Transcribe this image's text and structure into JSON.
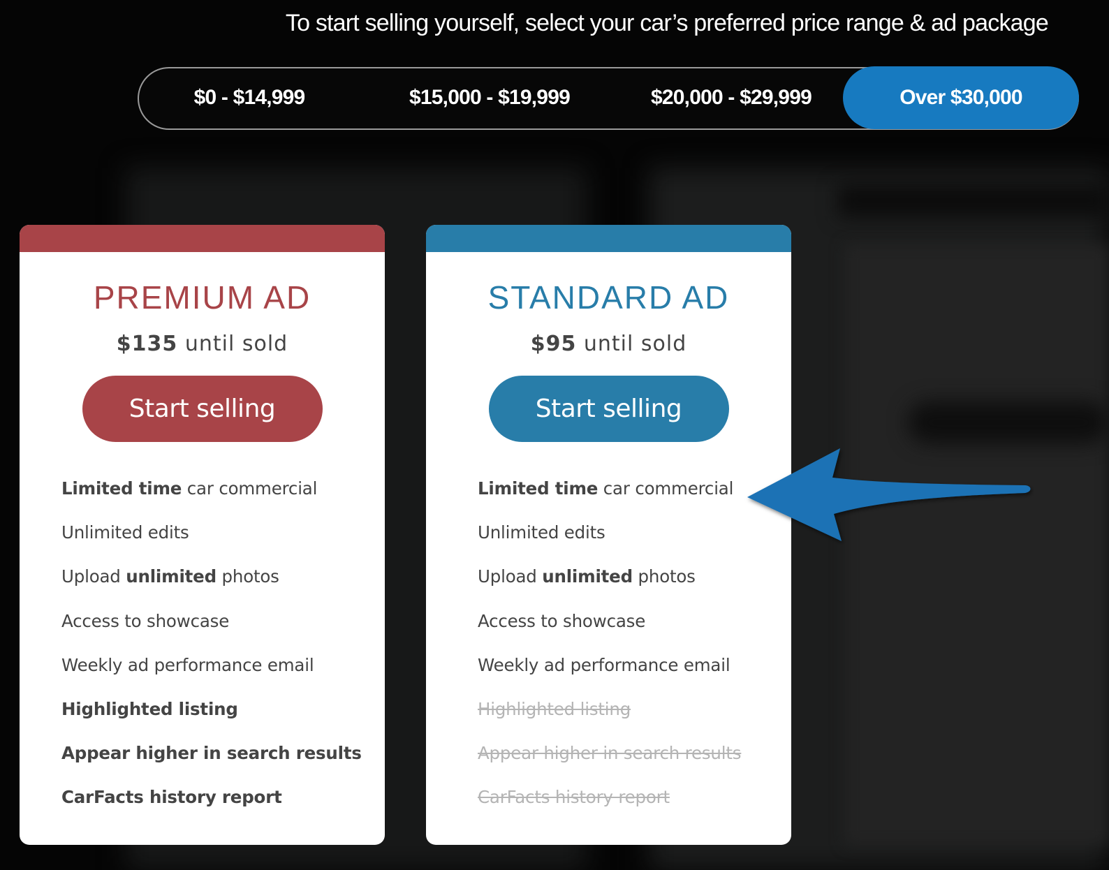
{
  "headline": "To start selling yourself, select your car’s preferred price range & ad package",
  "price_ranges": {
    "selected_index": 3,
    "options": [
      {
        "label": "$0 - $14,999",
        "selected": false
      },
      {
        "label": "$15,000 - $19,999",
        "selected": false
      },
      {
        "label": "$20,000 - $29,999",
        "selected": false
      },
      {
        "label": "Over $30,000",
        "selected": true
      }
    ]
  },
  "colors": {
    "premium": "#a84448",
    "standard": "#287da9",
    "selected_range": "#177ac0",
    "annotation_arrow": "#1b72b5"
  },
  "packages": [
    {
      "name": "PREMIUM AD",
      "price": "$135",
      "price_suffix": " until sold",
      "cta": "Start selling",
      "features": [
        {
          "parts": [
            {
              "text": "Limited time",
              "bold": true
            },
            {
              "text": " car commercial",
              "bold": false
            }
          ],
          "included": true
        },
        {
          "parts": [
            {
              "text": "Unlimited edits",
              "bold": false
            }
          ],
          "included": true
        },
        {
          "parts": [
            {
              "text": "Upload ",
              "bold": false
            },
            {
              "text": "unlimited",
              "bold": true
            },
            {
              "text": " photos",
              "bold": false
            }
          ],
          "included": true
        },
        {
          "parts": [
            {
              "text": "Access to showcase",
              "bold": false
            }
          ],
          "included": true
        },
        {
          "parts": [
            {
              "text": "Weekly ad performance email",
              "bold": false
            }
          ],
          "included": true
        },
        {
          "parts": [
            {
              "text": "Highlighted listing",
              "bold": true
            }
          ],
          "included": true
        },
        {
          "parts": [
            {
              "text": "Appear higher in search results",
              "bold": true
            }
          ],
          "included": true
        },
        {
          "parts": [
            {
              "text": "CarFacts history report",
              "bold": true
            }
          ],
          "included": true
        }
      ]
    },
    {
      "name": "STANDARD AD",
      "price": "$95",
      "price_suffix": " until sold",
      "cta": "Start selling",
      "features": [
        {
          "parts": [
            {
              "text": "Limited time",
              "bold": true
            },
            {
              "text": " car commercial",
              "bold": false
            }
          ],
          "included": true
        },
        {
          "parts": [
            {
              "text": "Unlimited edits",
              "bold": false
            }
          ],
          "included": true
        },
        {
          "parts": [
            {
              "text": "Upload ",
              "bold": false
            },
            {
              "text": "unlimited",
              "bold": true
            },
            {
              "text": " photos",
              "bold": false
            }
          ],
          "included": true
        },
        {
          "parts": [
            {
              "text": "Access to showcase",
              "bold": false
            }
          ],
          "included": true
        },
        {
          "parts": [
            {
              "text": "Weekly ad performance email",
              "bold": false
            }
          ],
          "included": true
        },
        {
          "parts": [
            {
              "text": "Highlighted listing",
              "bold": false
            }
          ],
          "included": false
        },
        {
          "parts": [
            {
              "text": "Appear higher in search results",
              "bold": false
            }
          ],
          "included": false
        },
        {
          "parts": [
            {
              "text": "CarFacts history report",
              "bold": false
            }
          ],
          "included": false
        }
      ]
    }
  ],
  "annotation": {
    "icon": "arrow-left-icon",
    "points_to": "Limited time car commercial (Standard Ad)"
  }
}
